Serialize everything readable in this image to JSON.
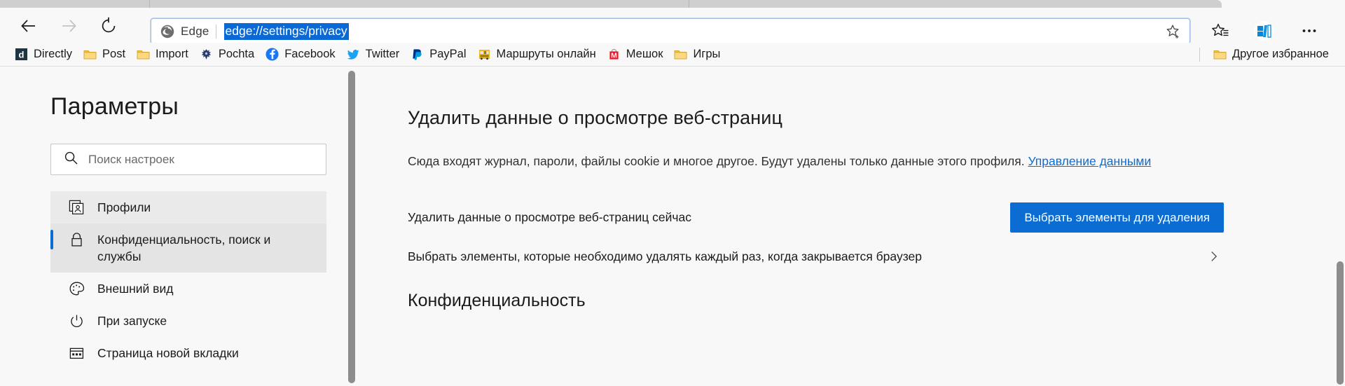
{
  "browser": {
    "name": "Edge",
    "nav": {
      "back": "back-arrow",
      "forward": "forward-arrow",
      "refresh": "refresh-arrow"
    },
    "omnibox": {
      "chip_label": "Edge",
      "url": "edge://settings/privacy",
      "selected": true,
      "favorite_icon": "star-add-icon"
    },
    "toolbar_icons": [
      {
        "name": "favorites-icon",
        "label": ""
      },
      {
        "name": "collections-icon",
        "label": ""
      },
      {
        "name": "settings-more-icon",
        "label": ""
      }
    ],
    "bookmarks": [
      {
        "label": "Directly",
        "icon": "directly-icon"
      },
      {
        "label": "Post",
        "icon": "folder-icon"
      },
      {
        "label": "Import",
        "icon": "folder-icon"
      },
      {
        "label": "Pochta",
        "icon": "pochta-eagle-icon"
      },
      {
        "label": "Facebook",
        "icon": "facebook-icon"
      },
      {
        "label": "Twitter",
        "icon": "twitter-icon"
      },
      {
        "label": "PayPal",
        "icon": "paypal-icon"
      },
      {
        "label": "Маршруты онлайн",
        "icon": "bus-icon"
      },
      {
        "label": "Мешок",
        "icon": "meshok-icon"
      },
      {
        "label": "Игры",
        "icon": "folder-icon"
      }
    ],
    "other_favorites": {
      "label": "Другое избранное",
      "icon": "folder-icon"
    }
  },
  "settings": {
    "title": "Параметры",
    "search": {
      "placeholder": "Поиск настроек",
      "value": "",
      "icon": "search-icon"
    },
    "nav_items": [
      {
        "label": "Профили",
        "icon": "profiles-icon",
        "state": "hover"
      },
      {
        "label": "Конфиденциальность, поиск и службы",
        "icon": "lock-icon",
        "state": "selected"
      },
      {
        "label": "Внешний вид",
        "icon": "palette-icon",
        "state": "normal"
      },
      {
        "label": "При запуске",
        "icon": "power-icon",
        "state": "normal"
      },
      {
        "label": "Страница новой вкладки",
        "icon": "newtab-icon",
        "state": "normal"
      }
    ]
  },
  "main": {
    "heading": "Удалить данные о просмотре веб-страниц",
    "description_part1": "Сюда входят журнал, пароли, файлы cookie и многое другое. Будут удалены только данные этого профиля. ",
    "description_link": "Управление данными",
    "rows": [
      {
        "label": "Удалить данные о просмотре веб-страниц сейчас",
        "action_label": "Выбрать элементы для удаления",
        "action_type": "button"
      },
      {
        "label": "Выбрать элементы, которые необходимо удалять каждый раз, когда закрывается браузер",
        "action_label": "",
        "action_type": "chevron"
      }
    ],
    "section_heading": "Конфиденциальность"
  },
  "colors": {
    "accent": "#0b6cd4",
    "link": "#0b6cd4",
    "selection": "#0a69d4",
    "page_bg": "#f8f8f8",
    "nav_selected_bg": "#e4e4e4",
    "nav_hover_bg": "#eaeaea",
    "scrollbar_thumb": "#8d8d8d"
  }
}
